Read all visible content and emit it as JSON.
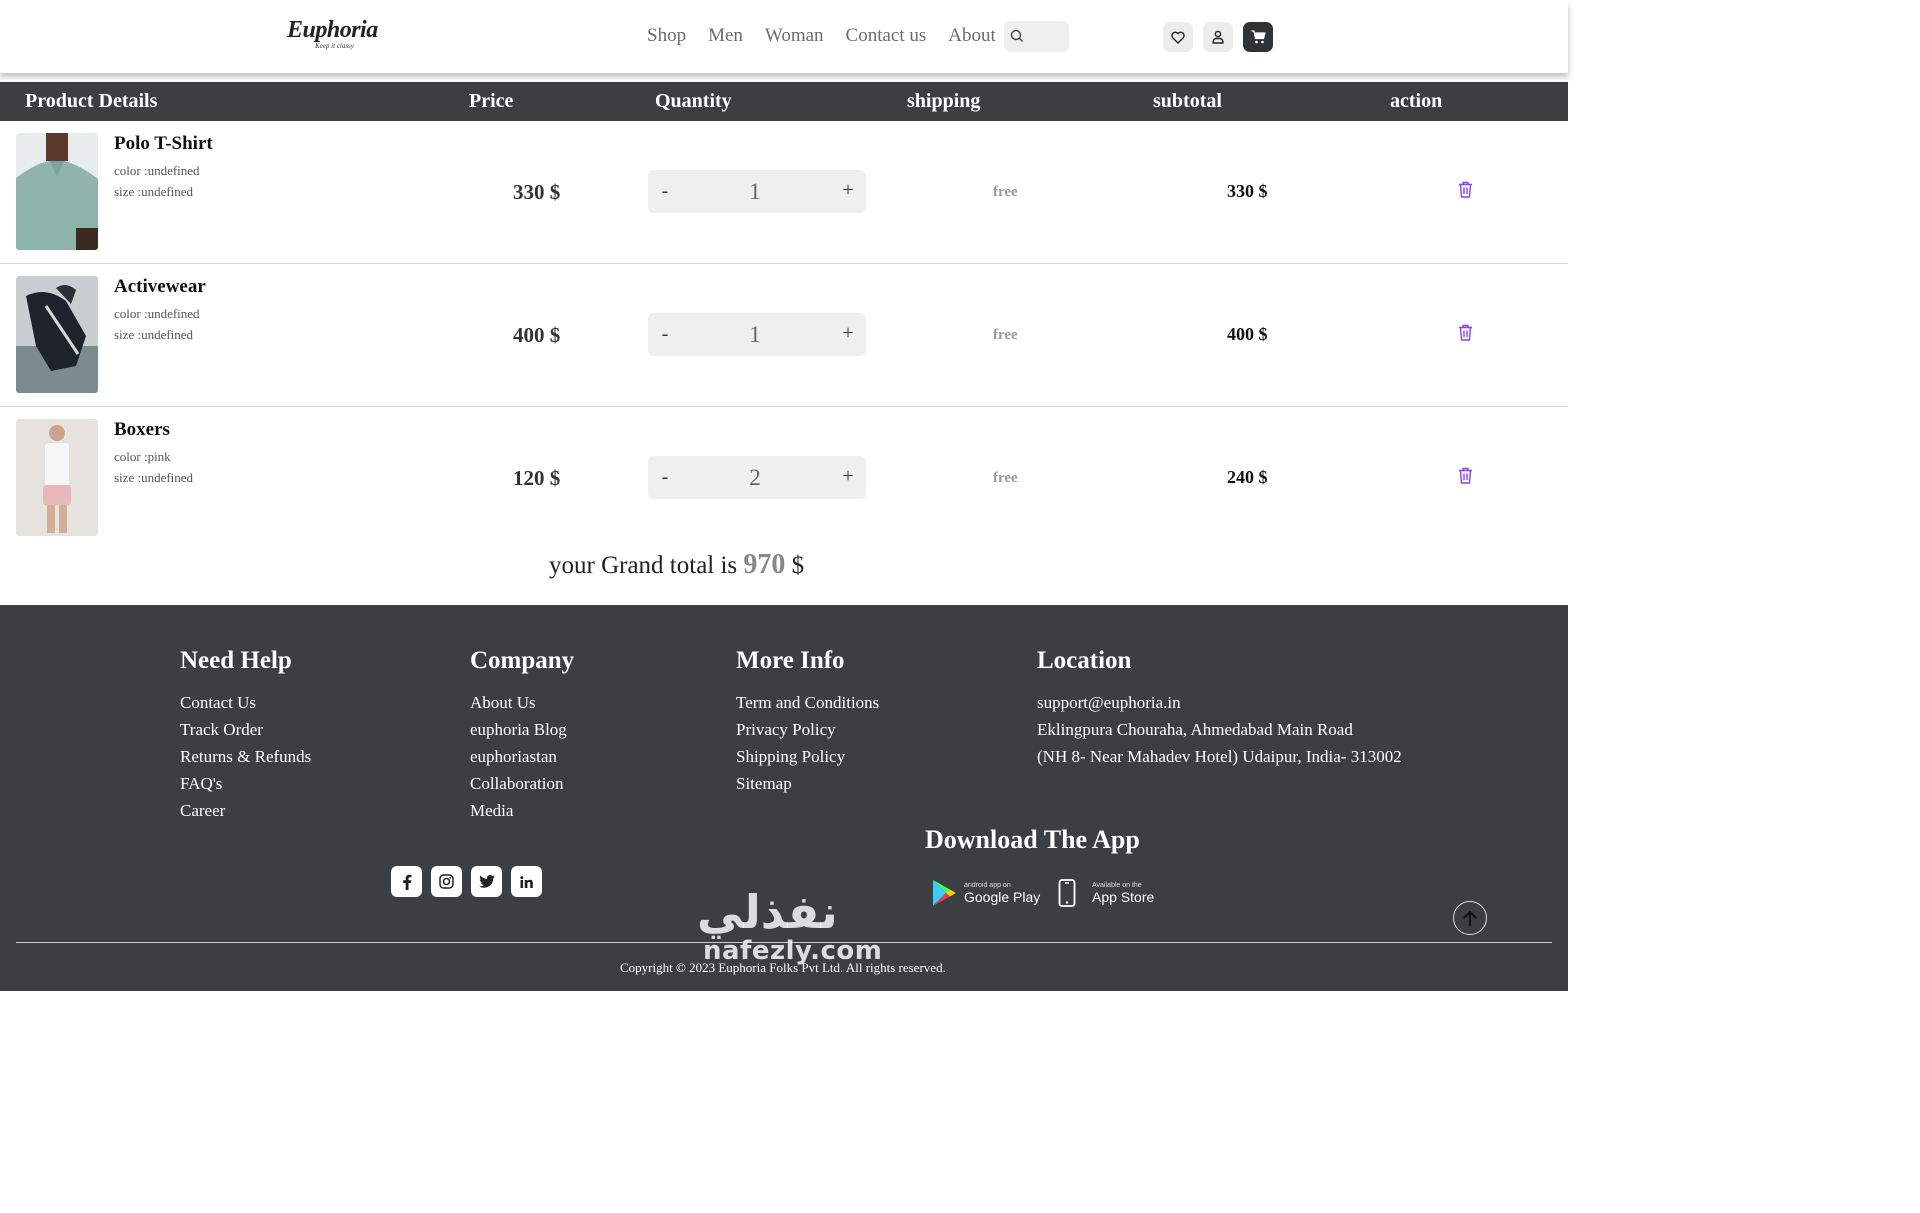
{
  "header": {
    "logo_text": "Euphoria",
    "logo_tagline": "Keep it classy",
    "nav": [
      "Shop",
      "Men",
      "Woman",
      "Contact us",
      "About"
    ],
    "search_placeholder": ""
  },
  "table": {
    "headers": [
      "Product Details",
      "Price",
      "Quantity",
      "shipping",
      "subtotal",
      "action"
    ],
    "rows": [
      {
        "name": "Polo T-Shirt",
        "color": "color :undefined",
        "size": "size :undefined",
        "price": "330 $",
        "qty": "1",
        "shipping": "free",
        "subtotal": "330 $",
        "minus": "-",
        "plus": "+"
      },
      {
        "name": "Activewear",
        "color": "color :undefined",
        "size": "size :undefined",
        "price": "400 $",
        "qty": "1",
        "shipping": "free",
        "subtotal": "400 $",
        "minus": "-",
        "plus": "+"
      },
      {
        "name": "Boxers",
        "color": "color :pink",
        "size": "size :undefined",
        "price": "120 $",
        "qty": "2",
        "shipping": "free",
        "subtotal": "240 $",
        "minus": "-",
        "plus": "+"
      }
    ]
  },
  "grand_total": {
    "prefix": "your Grand total is",
    "value": "970",
    "currency": "$"
  },
  "footer": {
    "need_help": {
      "title": "Need Help",
      "links": [
        "Contact Us",
        "Track Order",
        "Returns & Refunds",
        "FAQ's",
        "Career"
      ]
    },
    "company": {
      "title": "Company",
      "links": [
        "About Us",
        "euphoria Blog",
        "euphoriastan",
        "Collaboration",
        "Media"
      ]
    },
    "more_info": {
      "title": "More Info",
      "links": [
        "Term and Conditions",
        "Privacy Policy",
        "Shipping Policy",
        "Sitemap"
      ]
    },
    "location": {
      "title": "Location",
      "lines": [
        "support@euphoria.in",
        "Eklingpura Chouraha, Ahmedabad Main Road",
        "(NH 8- Near Mahadev Hotel) Udaipur, India- 313002"
      ]
    },
    "download_title": "Download The App",
    "google_play": {
      "small": "android app on",
      "big": "Google Play"
    },
    "app_store": {
      "small": "Available on the",
      "big": "App Store"
    },
    "social_icons": [
      "facebook-icon",
      "instagram-icon",
      "twitter-icon",
      "linkedin-icon"
    ],
    "copyright": "Copyright © 2023 Euphoria Folks Pvt Ltd. All rights reserved."
  },
  "watermark": {
    "arabic": "نفذلي",
    "latin": "nafezly.com"
  },
  "colors": {
    "dark_bg": "#3b3f42",
    "accent_trash": "#8a3ffc",
    "muted": "#999999"
  }
}
